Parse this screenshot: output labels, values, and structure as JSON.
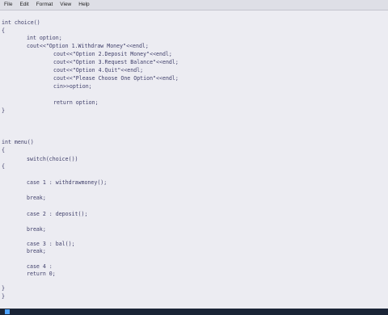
{
  "menubar": {
    "items": [
      "File",
      "Edit",
      "Format",
      "View",
      "Help"
    ]
  },
  "editor": {
    "lines": [
      "int choice()",
      "{",
      "int option;",
      "cout<<\"Option 1.Withdraw Money\"<<endl;",
      "cout<<\"Option 2.Deposit Money\"<<endl;",
      "cout<<\"Option 3.Request Balance\"<<endl;",
      "cout<<\"Option 4.Quit\"<<endl;",
      "cout<<\"Please Choose One Option\"<<endl;",
      "cin>>option;",
      "return option;",
      "}",
      "int menu()",
      "{",
      "switch(choice())",
      "{",
      "case 1 : withdrawmoney();",
      "break;",
      "case 2 : deposit();",
      "break;",
      "case 3 : bal();",
      "break;",
      "case 4 :",
      "return 0;",
      "}",
      "}"
    ]
  },
  "colors": {
    "code_text": "#3f3f6a",
    "editor_bg": "#ececf2",
    "taskbar": "#1a2436"
  },
  "taskbar": {
    "start_icon": "windows-start-icon"
  }
}
